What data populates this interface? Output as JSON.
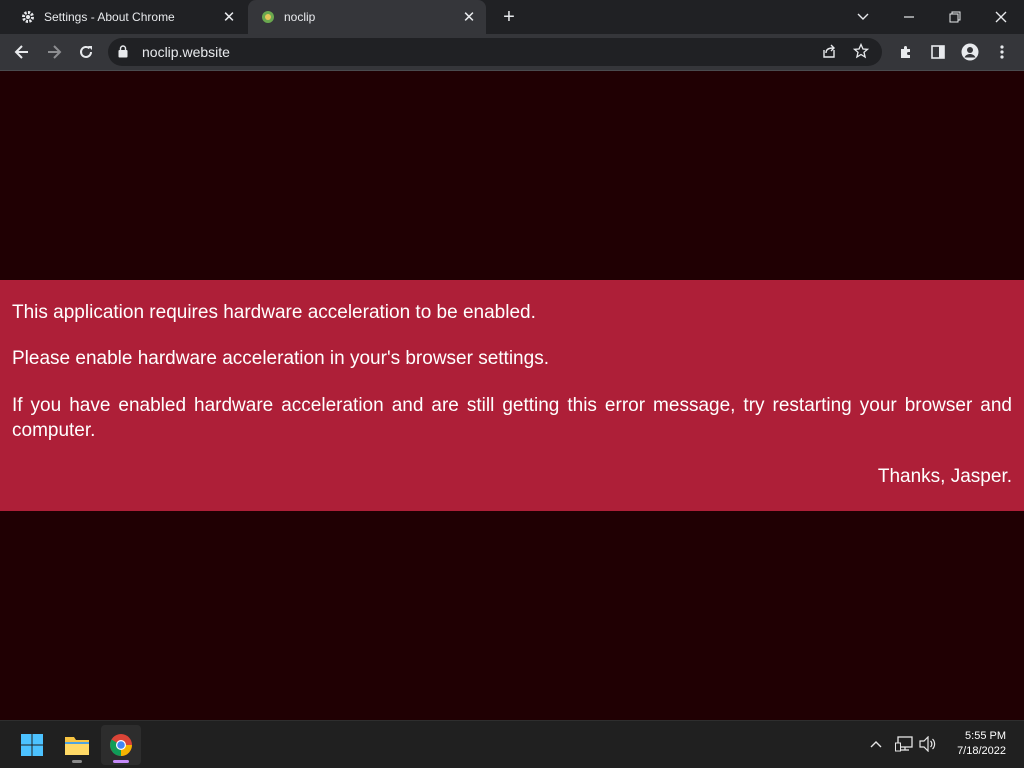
{
  "browser": {
    "tabs": [
      {
        "title": "Settings - About Chrome",
        "icon": "gear-icon",
        "active": false
      },
      {
        "title": "noclip",
        "icon": "noclip-favicon",
        "active": true
      }
    ],
    "address_bar": {
      "url": "noclip.website"
    }
  },
  "page": {
    "message_lines": [
      "This application requires hardware acceleration to be enabled.",
      "Please enable hardware acceleration in your's browser settings.",
      "If you have enabled hardware acceleration and are still getting this error message, try restarting your browser and computer.",
      "Thanks, Jasper."
    ],
    "colors": {
      "background": "#200003",
      "banner": "#ae1f38",
      "text": "#ffffff"
    }
  },
  "taskbar": {
    "apps": [
      "start-icon",
      "file-explorer-icon",
      "chrome-icon"
    ],
    "clock": {
      "time": "5:55 PM",
      "date": "7/18/2022"
    }
  }
}
